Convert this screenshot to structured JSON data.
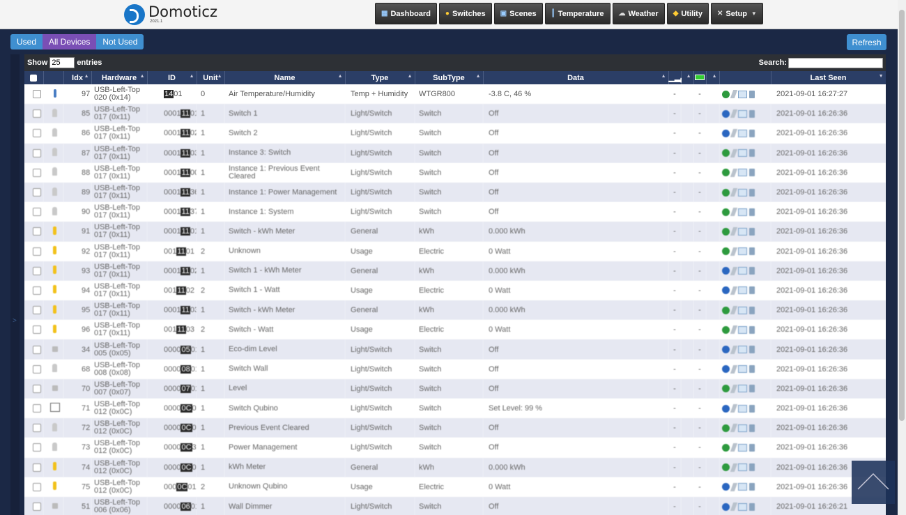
{
  "app": {
    "name": "Domoticz",
    "version": "2021.1"
  },
  "nav": [
    {
      "label": "Dashboard",
      "icon": "dashboard-icon"
    },
    {
      "label": "Switches",
      "icon": "lightbulb-icon"
    },
    {
      "label": "Scenes",
      "icon": "scenes-icon"
    },
    {
      "label": "Temperature",
      "icon": "thermometer-icon"
    },
    {
      "label": "Weather",
      "icon": "cloud-icon"
    },
    {
      "label": "Utility",
      "icon": "utility-icon"
    },
    {
      "label": "Setup",
      "icon": "tools-icon",
      "dropdown": true
    }
  ],
  "filters": {
    "used": "Used",
    "all": "All Devices",
    "not_used": "Not Used",
    "active": "all"
  },
  "refresh_label": "Refresh",
  "table_controls": {
    "show_label": "Show",
    "page_size": "25",
    "entries_label": "entries",
    "search_label": "Search:",
    "search_value": ""
  },
  "columns": [
    "Idx",
    "Hardware",
    "ID",
    "Unit",
    "Name",
    "Type",
    "SubType",
    "Data",
    "Last Seen"
  ],
  "rows": [
    {
      "idx": "97",
      "hw1": "USB-Left-Top",
      "hw2": "020 (0x14)",
      "id_pre": "",
      "id_mask": "14",
      "id_suf": "01",
      "unit": "0",
      "name": "Air Temperature/Humidity",
      "type": "Temp + Humidity",
      "subtype": "WTGR800",
      "data": "-3.8 C, 46 %",
      "sig": "-",
      "bat": "-",
      "log": "green",
      "last": "2021-09-01 16:27:27",
      "icon": "temp"
    },
    {
      "idx": "85",
      "hw1": "USB-Left-Top",
      "hw2": "017 (0x11)",
      "id_pre": "0001",
      "id_mask": "11",
      "id_suf": "01",
      "unit": "1",
      "name": "Switch 1",
      "type": "Light/Switch",
      "subtype": "Switch",
      "data": "Off",
      "sig": "-",
      "bat": "-",
      "log": "blue",
      "last": "2021-09-01 16:26:36",
      "icon": "bulb"
    },
    {
      "idx": "86",
      "hw1": "USB-Left-Top",
      "hw2": "017 (0x11)",
      "id_pre": "0001",
      "id_mask": "11",
      "id_suf": "02",
      "unit": "1",
      "name": "Switch 2",
      "type": "Light/Switch",
      "subtype": "Switch",
      "data": "Off",
      "sig": "-",
      "bat": "-",
      "log": "blue",
      "last": "2021-09-01 16:26:36",
      "icon": "bulb"
    },
    {
      "idx": "87",
      "hw1": "USB-Left-Top",
      "hw2": "017 (0x11)",
      "id_pre": "0001",
      "id_mask": "11",
      "id_suf": "03",
      "unit": "1",
      "name": "Instance 3: Switch",
      "type": "Light/Switch",
      "subtype": "Switch",
      "data": "Off",
      "sig": "-",
      "bat": "-",
      "log": "green",
      "last": "2021-09-01 16:26:36",
      "icon": "bulb"
    },
    {
      "idx": "88",
      "hw1": "USB-Left-Top",
      "hw2": "017 (0x11)",
      "id_pre": "0001",
      "id_mask": "11",
      "id_suf": "00",
      "unit": "1",
      "name": "Instance 1: Previous Event Cleared",
      "type": "Light/Switch",
      "subtype": "Switch",
      "data": "Off",
      "sig": "-",
      "bat": "-",
      "log": "green",
      "last": "2021-09-01 16:26:36",
      "icon": "bulb"
    },
    {
      "idx": "89",
      "hw1": "USB-Left-Top",
      "hw2": "017 (0x11)",
      "id_pre": "0001",
      "id_mask": "11",
      "id_suf": "36",
      "unit": "1",
      "name": "Instance 1: Power Management",
      "type": "Light/Switch",
      "subtype": "Switch",
      "data": "Off",
      "sig": "-",
      "bat": "-",
      "log": "green",
      "last": "2021-09-01 16:26:36",
      "icon": "bulb"
    },
    {
      "idx": "90",
      "hw1": "USB-Left-Top",
      "hw2": "017 (0x11)",
      "id_pre": "0001",
      "id_mask": "11",
      "id_suf": "37",
      "unit": "1",
      "name": "Instance 1: System",
      "type": "Light/Switch",
      "subtype": "Switch",
      "data": "Off",
      "sig": "-",
      "bat": "-",
      "log": "green",
      "last": "2021-09-01 16:26:36",
      "icon": "bulb"
    },
    {
      "idx": "91",
      "hw1": "USB-Left-Top",
      "hw2": "017 (0x11)",
      "id_pre": "0001",
      "id_mask": "11",
      "id_suf": "01",
      "unit": "1",
      "name": "Switch - kWh Meter",
      "type": "General",
      "subtype": "kWh",
      "data": "0.000 kWh",
      "sig": "-",
      "bat": "-",
      "log": "green",
      "last": "2021-09-01 16:26:36",
      "icon": "bolt"
    },
    {
      "idx": "92",
      "hw1": "USB-Left-Top",
      "hw2": "017 (0x11)",
      "id_pre": "001",
      "id_mask": "11",
      "id_suf": "01",
      "unit": "2",
      "name": "Unknown",
      "type": "Usage",
      "subtype": "Electric",
      "data": "0 Watt",
      "sig": "-",
      "bat": "-",
      "log": "green",
      "last": "2021-09-01 16:26:36",
      "icon": "bolt"
    },
    {
      "idx": "93",
      "hw1": "USB-Left-Top",
      "hw2": "017 (0x11)",
      "id_pre": "0001",
      "id_mask": "11",
      "id_suf": "02",
      "unit": "1",
      "name": "Switch 1 - kWh Meter",
      "type": "General",
      "subtype": "kWh",
      "data": "0.000 kWh",
      "sig": "-",
      "bat": "-",
      "log": "blue",
      "last": "2021-09-01 16:26:36",
      "icon": "bolt"
    },
    {
      "idx": "94",
      "hw1": "USB-Left-Top",
      "hw2": "017 (0x11)",
      "id_pre": "001",
      "id_mask": "11",
      "id_suf": "02",
      "unit": "2",
      "name": "Switch 1 - Watt",
      "type": "Usage",
      "subtype": "Electric",
      "data": "0 Watt",
      "sig": "-",
      "bat": "-",
      "log": "blue",
      "last": "2021-09-01 16:26:36",
      "icon": "bolt"
    },
    {
      "idx": "95",
      "hw1": "USB-Left-Top",
      "hw2": "017 (0x11)",
      "id_pre": "0001",
      "id_mask": "11",
      "id_suf": "03",
      "unit": "1",
      "name": "Switch - kWh Meter",
      "type": "General",
      "subtype": "kWh",
      "data": "0.000 kWh",
      "sig": "-",
      "bat": "-",
      "log": "green",
      "last": "2021-09-01 16:26:36",
      "icon": "bolt"
    },
    {
      "idx": "96",
      "hw1": "USB-Left-Top",
      "hw2": "017 (0x11)",
      "id_pre": "001",
      "id_mask": "11",
      "id_suf": "03",
      "unit": "2",
      "name": "Switch - Watt",
      "type": "Usage",
      "subtype": "Electric",
      "data": "0 Watt",
      "sig": "-",
      "bat": "-",
      "log": "green",
      "last": "2021-09-01 16:26:36",
      "icon": "bolt"
    },
    {
      "idx": "34",
      "hw1": "USB-Left-Top",
      "hw2": "005 (0x05)",
      "id_pre": "0000",
      "id_mask": "05",
      "id_suf": "01",
      "unit": "1",
      "name": "Eco-dim Level",
      "type": "Light/Switch",
      "subtype": "Switch",
      "data": "Off",
      "sig": "-",
      "bat": "-",
      "log": "blue",
      "last": "2021-09-01 16:26:36",
      "icon": "dim"
    },
    {
      "idx": "68",
      "hw1": "USB-Left-Top",
      "hw2": "008 (0x08)",
      "id_pre": "0000",
      "id_mask": "08",
      "id_suf": "01",
      "unit": "1",
      "name": "Switch Wall",
      "type": "Light/Switch",
      "subtype": "Switch",
      "data": "Off",
      "sig": "-",
      "bat": "-",
      "log": "blue",
      "last": "2021-09-01 16:26:36",
      "icon": "bulb"
    },
    {
      "idx": "70",
      "hw1": "USB-Left-Top",
      "hw2": "007 (0x07)",
      "id_pre": "0000",
      "id_mask": "07",
      "id_suf": "01",
      "unit": "1",
      "name": "Level",
      "type": "Light/Switch",
      "subtype": "Switch",
      "data": "Off",
      "sig": "-",
      "bat": "-",
      "log": "green",
      "last": "2021-09-01 16:26:36",
      "icon": "dim"
    },
    {
      "idx": "71",
      "hw1": "USB-Left-Top",
      "hw2": "012 (0x0C)",
      "id_pre": "0000",
      "id_mask": "0C",
      "id_suf": "01",
      "unit": "1",
      "name": "Switch Qubino",
      "type": "Light/Switch",
      "subtype": "Switch",
      "data": "Set Level: 99 %",
      "sig": "-",
      "bat": "-",
      "log": "blue",
      "last": "2021-09-01 16:26:36",
      "icon": "box"
    },
    {
      "idx": "72",
      "hw1": "USB-Left-Top",
      "hw2": "012 (0x0C)",
      "id_pre": "0000",
      "id_mask": "0C",
      "id_suf": "00",
      "unit": "1",
      "name": "Previous Event Cleared",
      "type": "Light/Switch",
      "subtype": "Switch",
      "data": "Off",
      "sig": "-",
      "bat": "-",
      "log": "green",
      "last": "2021-09-01 16:26:36",
      "icon": "bulb"
    },
    {
      "idx": "73",
      "hw1": "USB-Left-Top",
      "hw2": "012 (0x0C)",
      "id_pre": "0000",
      "id_mask": "0C",
      "id_suf": "36",
      "unit": "1",
      "name": "Power Management",
      "type": "Light/Switch",
      "subtype": "Switch",
      "data": "Off",
      "sig": "-",
      "bat": "-",
      "log": "green",
      "last": "2021-09-01 16:26:36",
      "icon": "bulb"
    },
    {
      "idx": "74",
      "hw1": "USB-Left-Top",
      "hw2": "012 (0x0C)",
      "id_pre": "0000",
      "id_mask": "0C",
      "id_suf": "01",
      "unit": "1",
      "name": "kWh Meter",
      "type": "General",
      "subtype": "kWh",
      "data": "0.000 kWh",
      "sig": "-",
      "bat": "-",
      "log": "green",
      "last": "2021-09-01 16:26:36",
      "icon": "bolt"
    },
    {
      "idx": "75",
      "hw1": "USB-Left-Top",
      "hw2": "012 (0x0C)",
      "id_pre": "000",
      "id_mask": "0C",
      "id_suf": "01",
      "unit": "2",
      "name": "Unknown Qubino",
      "type": "Usage",
      "subtype": "Electric",
      "data": "0 Watt",
      "sig": "-",
      "bat": "-",
      "log": "blue",
      "last": "2021-09-01 16:26:36",
      "icon": "bolt"
    },
    {
      "idx": "51",
      "hw1": "USB-Left-Top",
      "hw2": "006 (0x06)",
      "id_pre": "0000",
      "id_mask": "06",
      "id_suf": "01",
      "unit": "1",
      "name": "Wall Dimmer",
      "type": "Light/Switch",
      "subtype": "Switch",
      "data": "Off",
      "sig": "-",
      "bat": "-",
      "log": "blue",
      "last": "2021-09-01 16:26:21",
      "icon": "dim"
    }
  ]
}
